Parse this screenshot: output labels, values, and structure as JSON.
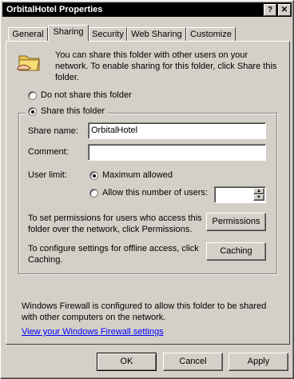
{
  "window": {
    "title": "OrbitalHotel Properties",
    "help_glyph": "?",
    "close_glyph": "✕"
  },
  "tabs": [
    {
      "label": "General"
    },
    {
      "label": "Sharing",
      "active": true
    },
    {
      "label": "Security"
    },
    {
      "label": "Web Sharing"
    },
    {
      "label": "Customize"
    }
  ],
  "intro": {
    "icon": "shared-folder-icon",
    "lines": [
      "You can share this folder with other users on your",
      "network. To enable sharing for this folder, click Share this",
      "folder."
    ]
  },
  "radio_not_share": {
    "label": "Do not share this folder",
    "checked": false
  },
  "radio_share": {
    "label": "Share this folder",
    "checked": true
  },
  "share_name": {
    "label": "Share name:",
    "value": "OrbitalHotel"
  },
  "comment": {
    "label": "Comment:",
    "value": ""
  },
  "user_limit": {
    "label": "User limit:",
    "max_label": "Maximum allowed",
    "max_checked": true,
    "allow_label": "Allow this number of users:",
    "allow_checked": false,
    "count_value": ""
  },
  "permissions": {
    "lines": [
      "To set permissions for users who access this",
      "folder over the network, click Permissions."
    ],
    "button": "Permissions"
  },
  "caching": {
    "lines": [
      "To configure settings for offline access, click",
      "Caching."
    ],
    "button": "Caching"
  },
  "firewall": {
    "lines": [
      "Windows Firewall is configured to allow this folder to be shared",
      "with other computers on the network."
    ],
    "link": "View your Windows Firewall settings"
  },
  "footer": {
    "ok": "OK",
    "cancel": "Cancel",
    "apply": "Apply"
  }
}
